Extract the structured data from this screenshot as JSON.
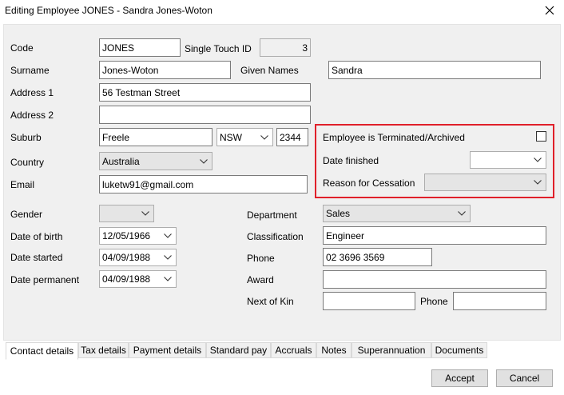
{
  "window": {
    "title": "Editing Employee JONES - Sandra Jones-Woton"
  },
  "form": {
    "code_label": "Code",
    "code_value": "JONES",
    "single_touch_label": "Single Touch ID",
    "single_touch_value": "3",
    "surname_label": "Surname",
    "surname_value": "Jones-Woton",
    "given_names_label": "Given Names",
    "given_names_value": "Sandra",
    "address1_label": "Address 1",
    "address1_value": "56 Testman Street",
    "address2_label": "Address 2",
    "address2_value": "",
    "suburb_label": "Suburb",
    "suburb_value": "Freele",
    "state_value": "NSW",
    "postcode_value": "2344",
    "country_label": "Country",
    "country_value": "Australia",
    "email_label": "Email",
    "email_value": "luketw91@gmail.com",
    "gender_label": "Gender",
    "gender_value": "",
    "dob_label": "Date of birth",
    "dob_value": "12/05/1966",
    "date_started_label": "Date started",
    "date_started_value": "04/09/1988",
    "date_permanent_label": "Date permanent",
    "date_permanent_value": "04/09/1988",
    "department_label": "Department",
    "department_value": "Sales",
    "classification_label": "Classification",
    "classification_value": "Engineer",
    "phone_label": "Phone",
    "phone_value": "02 3696 3569",
    "award_label": "Award",
    "award_value": "",
    "next_of_kin_label": "Next of Kin",
    "next_of_kin_value": "",
    "kin_phone_label": "Phone",
    "kin_phone_value": ""
  },
  "termination": {
    "terminated_label": "Employee is Terminated/Archived",
    "terminated_checked": false,
    "date_finished_label": "Date finished",
    "date_finished_value": "",
    "reason_label": "Reason for Cessation",
    "reason_value": "",
    "highlight_color": "#e0202a"
  },
  "tabs": [
    {
      "label": "Contact details"
    },
    {
      "label": "Tax details"
    },
    {
      "label": "Payment details"
    },
    {
      "label": "Standard pay"
    },
    {
      "label": "Accruals"
    },
    {
      "label": "Notes"
    },
    {
      "label": "Superannuation"
    },
    {
      "label": "Documents"
    }
  ],
  "buttons": {
    "accept": "Accept",
    "cancel": "Cancel"
  },
  "icons": {
    "close": "close-icon",
    "dropdown": "chevron-down-icon"
  }
}
